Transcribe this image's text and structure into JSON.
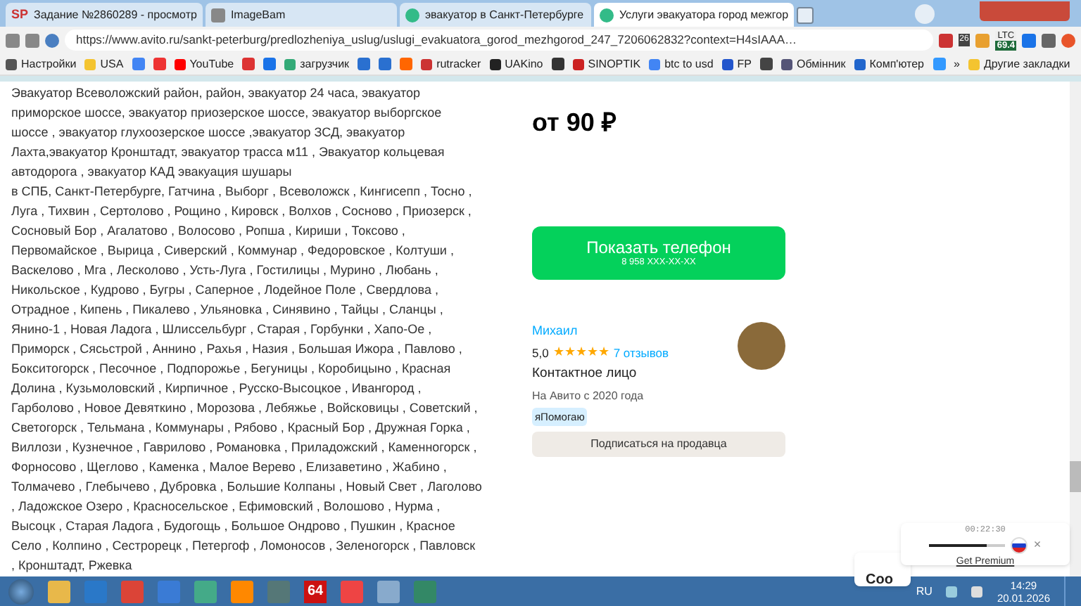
{
  "tabs": [
    {
      "label": "Задание №2860289 - просмотр",
      "icon": "SP",
      "selected": false
    },
    {
      "label": "ImageBam",
      "selected": false
    },
    {
      "label": "эвакуатор в Санкт-Петербурге",
      "selected": false
    },
    {
      "label": "Услуги эвакуатора город межгор",
      "selected": true
    }
  ],
  "address_bar": {
    "url": "https://www.avito.ru/sankt-peterburg/predlozheniya_uslug/uslugi_evakuatora_gorod_mezhgorod_247_7206062832?context=H4sIAAA…"
  },
  "extension_badges": {
    "count": "26",
    "ticker": "LTC",
    "price": "69.4"
  },
  "bookmarks": [
    {
      "kind": "link",
      "label": "Настройки"
    },
    {
      "kind": "link",
      "label": "USA"
    },
    {
      "kind": "icon"
    },
    {
      "kind": "icon"
    },
    {
      "kind": "link",
      "label": "YouTube"
    },
    {
      "kind": "icon"
    },
    {
      "kind": "icon"
    },
    {
      "kind": "link",
      "label": "загрузчик"
    },
    {
      "kind": "icon"
    },
    {
      "kind": "icon"
    },
    {
      "kind": "icon"
    },
    {
      "kind": "link",
      "label": "rutracker"
    },
    {
      "kind": "link",
      "label": "UAKino"
    },
    {
      "kind": "icon"
    },
    {
      "kind": "link",
      "label": "SINOPTIK"
    },
    {
      "kind": "link",
      "label": "btc to usd"
    },
    {
      "kind": "link",
      "label": "FP"
    },
    {
      "kind": "icon"
    },
    {
      "kind": "link",
      "label": "Обмінник"
    },
    {
      "kind": "link",
      "label": "Комп'ютер"
    },
    {
      "kind": "icon"
    }
  ],
  "bookmarks_more": "»",
  "other_bookmarks": "Другие закладки",
  "description": [
    [
      "Эвакуатор Всеволожский район, район, эвакуатор 24 часа, эвакуатор",
      "приморское шоссе, эвакуатор приозерское шоссе, эвакуатор выборгское",
      "шоссе , эвакуатор глухоозерское шоссе ,эвакуатор ЗСД, эвакуатор",
      "Лахта,эвакуатор Кронштадт, эвакуатор трасса м11 , Эвакуатор кольцевая",
      "автодорога , эвакуатор КАД эвакуация шушары"
    ],
    [
      "в СПБ, Санкт-Петербурге, Гатчина , Выборг , Всеволожск , Кингисепп , Тосно ,",
      "Луга , Тихвин , Сертолово , Рощино , Кировск , Волхов , Сосново , Приозерск ,",
      "Сосновый Бор , Агалатово , Волосово , Ропша , Кириши , Токсово ,",
      "Первомайское , Вырица , Сиверский , Коммунар , Федоровское , Колтуши ,",
      "Васкелово , Мга , Лесколово , Усть-Луга , Гостилицы , Мурино , Любань ,",
      "Никольское , Кудрово , Бугры , Саперное , Лодейное Поле , Свердлова ,",
      "Отрадное , Кипень , Пикалево , Ульяновка , Синявино , Тайцы , Сланцы ,",
      "Янино-1 , Новая Ладога , Шлиссельбург , Старая , Горбунки , Хапо-Ое ,",
      "Приморск , Сясьстрой , Аннино , Рахья , Назия , Большая Ижора , Павлово ,",
      "Бокситогорск , Песочное , Подпорожье , Бегуницы , Коробицыно , Красная",
      "Долина , Кузьмоловский , Кирпичное , Русско-Высоцкое , Ивангород ,",
      "Гарболово , Новое Девяткино , Морозова , Лебяжье , Войсковицы , Советский ,",
      "Светогорск , Тельмана , Коммунары , Рябово , Красный Бор , Дружная Горка ,",
      "Виллози , Кузнечное , Гаврилово , Романовка , Приладожский , Каменногорск ,",
      "Форносово , Щеглово , Каменка , Малое Верево , Елизаветино , Жабино ,",
      "Толмачево , Глебычево , Дубровка , Большие Колпаны , Новый Свет , Лаголово",
      ", Ладожское Озеро , Красносельское , Ефимовский , Волошово , Нурма ,",
      "Высоцк , Старая Ладога , Будогощь , Большое Ондрово , Пушкин , Красное",
      "Село , Колпино , Сестрорецк , Петергоф , Ломоносов , Зеленогорск , Павловск",
      ", Кронштадт, Ржевка"
    ]
  ],
  "price": "от 90 ₽",
  "phone_button": {
    "label": "Показать телефон",
    "number": "8 958 XXX-XX-XX"
  },
  "seller": {
    "name": "Михаил",
    "rating": "5,0",
    "stars": 5,
    "reviews": "7 отзывов",
    "role": "Контактное лицо",
    "since": "На Авито с 2020 года",
    "badge": "яПомогаю",
    "subscribe": "Подписаться на продавца"
  },
  "cookie_banner": {
    "text": "Coo"
  },
  "recorder_popup": {
    "time": "00:22:30",
    "level": 0.75,
    "close": "×",
    "link": "Get Premium"
  },
  "taskbar": {
    "app_badge": "64",
    "language": "RU",
    "time": "14:29",
    "date": "20.01.2026"
  }
}
